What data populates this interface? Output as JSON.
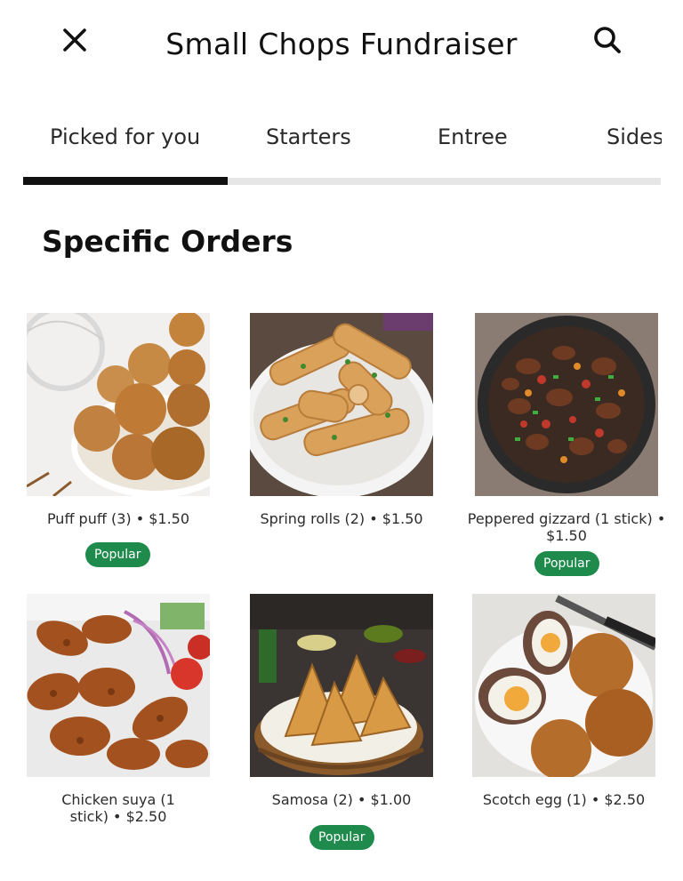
{
  "header": {
    "title": "Small Chops Fundraiser",
    "close_icon": "close-icon",
    "search_icon": "search-icon"
  },
  "tabs": [
    {
      "label": "Picked for you",
      "active": true
    },
    {
      "label": "Starters",
      "active": false
    },
    {
      "label": "Entree",
      "active": false
    },
    {
      "label": "Sides",
      "active": false
    }
  ],
  "section": {
    "title": "Specific Orders"
  },
  "items": [
    {
      "label": "Puff puff (3) • $1.50",
      "badge": "Popular",
      "image": "puff-puff-photo"
    },
    {
      "label": "Spring rolls (2) • $1.50",
      "badge": "",
      "image": "spring-rolls-photo"
    },
    {
      "label": "Peppered gizzard (1 stick) • $1.50",
      "badge": "Popular",
      "image": "peppered-gizzard-photo"
    },
    {
      "label": "Chicken suya (1 stick) • $2.50",
      "badge": "",
      "image": "chicken-suya-photo"
    },
    {
      "label": "Samosa (2) • $1.00",
      "badge": "Popular",
      "image": "samosa-photo"
    },
    {
      "label": "Scotch egg (1) • $2.50",
      "badge": "",
      "image": "scotch-egg-photo"
    }
  ],
  "colors": {
    "accent": "#1e8a4c",
    "tab_indicator": "#111111",
    "tab_track": "#e6e6e6"
  }
}
